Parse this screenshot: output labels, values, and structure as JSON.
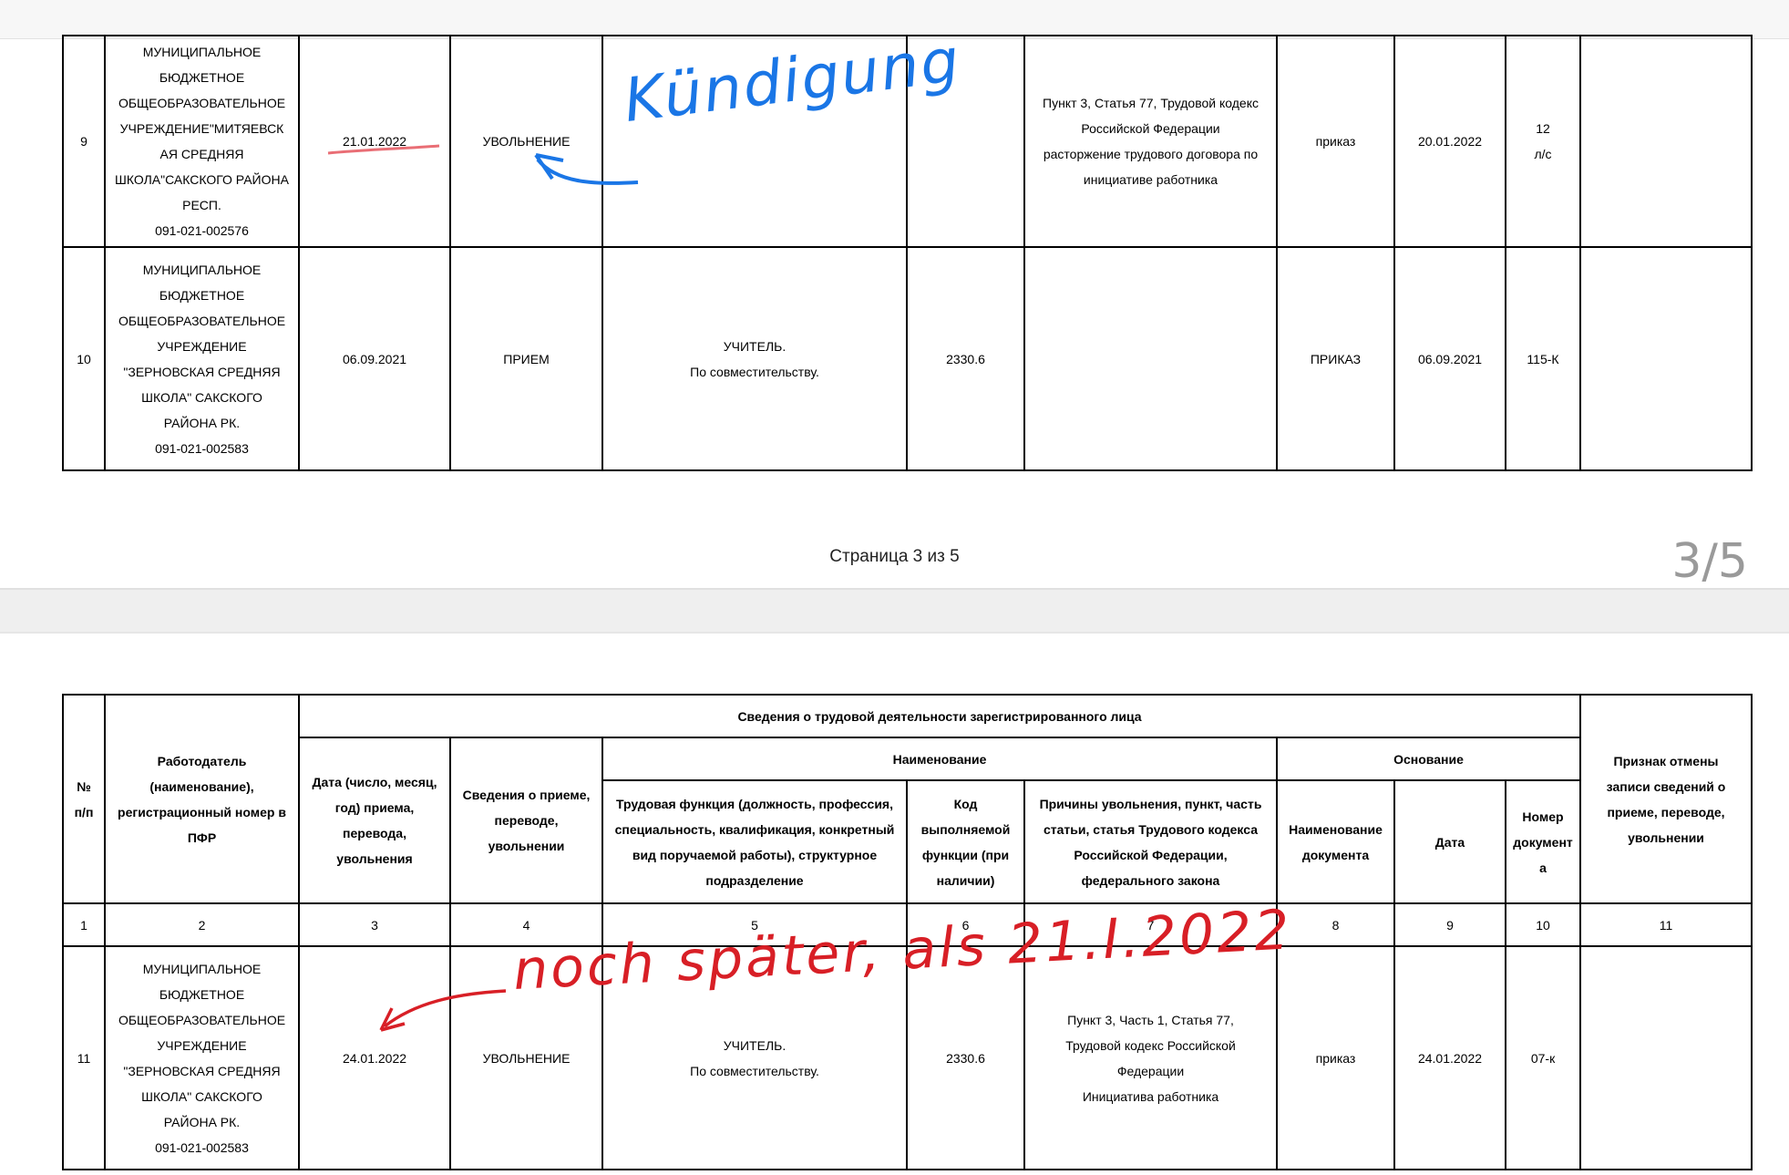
{
  "page_footer": "Страница 3 из 5",
  "page_counter": "3/5",
  "top_rows": [
    {
      "num": "9",
      "employer": "МУНИЦИПАЛЬНОЕ\nБЮДЖЕТНОЕ\nОБЩЕОБРАЗОВАТЕЛЬНОЕ\nУЧРЕЖДЕНИЕ\"МИТЯЕВСК\nАЯ СРЕДНЯЯ\nШКОЛА\"САКСКОГО РАЙОНА\nРЕСП.\n091-021-002576",
      "date": "21.01.2022",
      "event": "УВОЛЬНЕНИЕ",
      "function": "",
      "code": "",
      "reason": "Пункт 3,  Статья 77, Трудовой кодекс\nРоссийской Федерации\nрасторжение трудового договора по\nинициативе работника",
      "doc_name": "приказ",
      "doc_date": "20.01.2022",
      "doc_number": "12\nл/с",
      "cancel": ""
    },
    {
      "num": "10",
      "employer": "МУНИЦИПАЛЬНОЕ\nБЮДЖЕТНОЕ\nОБЩЕОБРАЗОВАТЕЛЬНОЕ\nУЧРЕЖДЕНИЕ\n\"ЗЕРНОВСКАЯ СРЕДНЯЯ\nШКОЛА\" САКСКОГО\nРАЙОНА РК.\n091-021-002583",
      "date": "06.09.2021",
      "event": "ПРИЕМ",
      "function": "УЧИТЕЛЬ.\nПо совместительству.",
      "code": "2330.6",
      "reason": "",
      "doc_name": "ПРИКАЗ",
      "doc_date": "06.09.2021",
      "doc_number": "115-К",
      "cancel": ""
    }
  ],
  "header": {
    "num": "№\nп/п",
    "employer": "Работодатель\n(наименование),\nрегистрационный номер в\nПФР",
    "info_group": "Сведения о трудовой деятельности зарегистрированного лица",
    "date": "Дата (число, месяц,\nгод) приема,\nперевода,\nувольнения",
    "event": "Сведения о приеме,\nпереводе,\nувольнении",
    "name_group": "Наименование",
    "function": "Трудовая функция (должность, профессия,\nспециальность, квалификация, конкретный\nвид поручаемой работы), структурное\nподразделение",
    "code": "Код\nвыполняемой\nфункции (при\nналичии)",
    "reason": "Причины увольнения, пункт, часть\nстатьи, статья Трудового кодекса\nРоссийской Федерации,\nфедерального закона",
    "basis_group": "Основание",
    "doc_name": "Наименование\nдокумента",
    "doc_date": "Дата",
    "doc_number": "Номер\nдокумент\nа",
    "cancel": "Признак отмены\nзаписи сведений о\nприеме, переводе,\nувольнении"
  },
  "column_numbers": [
    "1",
    "2",
    "3",
    "4",
    "5",
    "6",
    "7",
    "8",
    "9",
    "10",
    "11"
  ],
  "bottom_rows": [
    {
      "num": "11",
      "employer": "МУНИЦИПАЛЬНОЕ\nБЮДЖЕТНОЕ\nОБЩЕОБРАЗОВАТЕЛЬНОЕ\nУЧРЕЖДЕНИЕ\n\"ЗЕРНОВСКАЯ СРЕДНЯЯ\nШКОЛА\" САКСКОГО\nРАЙОНА РК.\n091-021-002583",
      "date": "24.01.2022",
      "event": "УВОЛЬНЕНИЕ",
      "function": "УЧИТЕЛЬ.\nПо совместительству.",
      "code": "2330.6",
      "reason": "Пункт 3,  Часть 1,  Статья 77,\nТрудовой кодекс Российской\nФедерации\nИнициатива работника",
      "doc_name": "приказ",
      "doc_date": "24.01.2022",
      "doc_number": "07-к",
      "cancel": ""
    }
  ],
  "annotations": {
    "blue_note": "Kündigung",
    "red_note": "noch später, als 21.I.2022",
    "blue_color": "#1a76e6",
    "red_color": "#d81f26"
  }
}
